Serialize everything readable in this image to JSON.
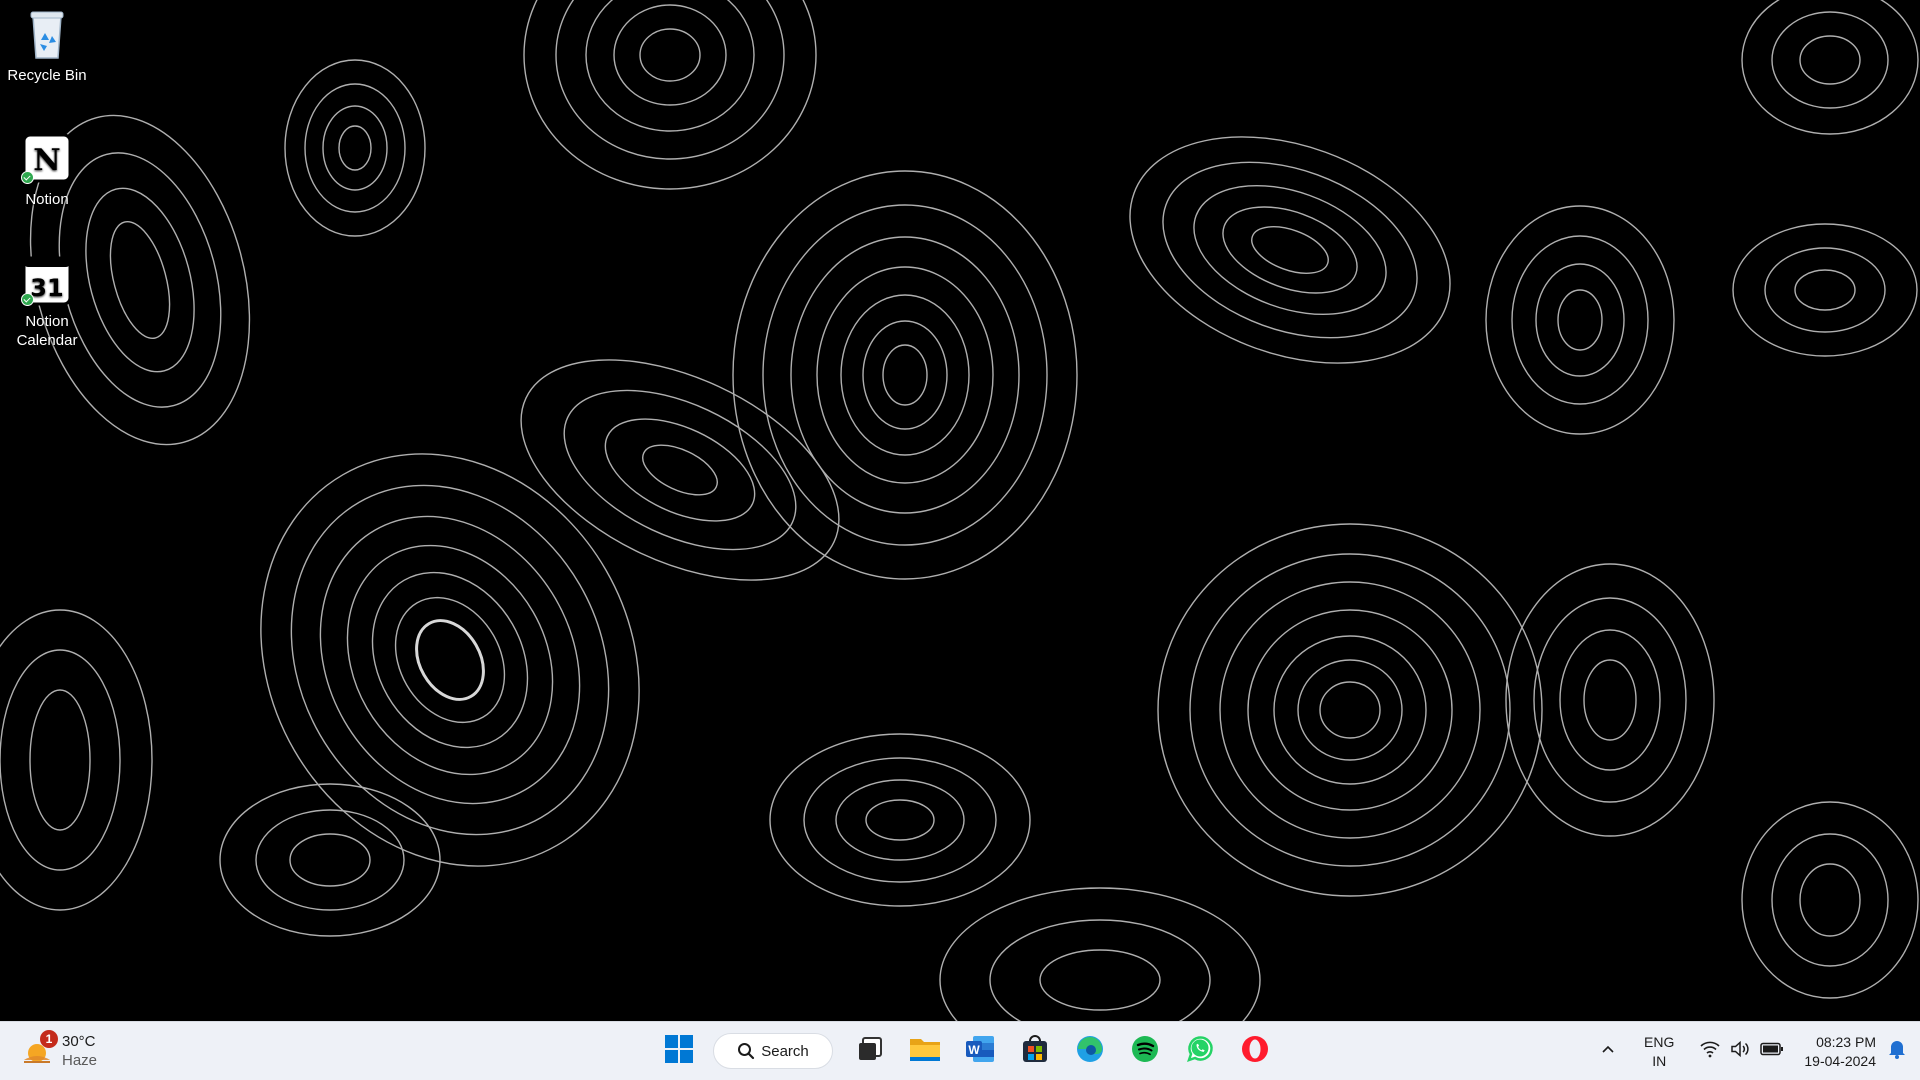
{
  "desktop": {
    "icons": [
      {
        "label": "Recycle Bin",
        "icon": "recycle-bin-icon"
      },
      {
        "label": "Notion",
        "icon": "notion-icon"
      },
      {
        "label": "Notion Calendar",
        "icon": "notion-calendar-icon",
        "date_number": "31"
      }
    ]
  },
  "taskbar": {
    "weather": {
      "temperature": "30°C",
      "condition": "Haze",
      "badge_count": "1",
      "icon": "weather-sun-icon"
    },
    "search": {
      "label": "Search"
    },
    "apps": [
      {
        "name": "Start",
        "icon": "windows-start-icon"
      },
      {
        "name": "Task View",
        "icon": "task-view-icon"
      },
      {
        "name": "File Explorer",
        "icon": "file-explorer-icon"
      },
      {
        "name": "Word",
        "icon": "word-icon",
        "letter": "W"
      },
      {
        "name": "Microsoft Store",
        "icon": "store-icon"
      },
      {
        "name": "Edge",
        "icon": "edge-icon"
      },
      {
        "name": "Spotify",
        "icon": "spotify-icon"
      },
      {
        "name": "WhatsApp",
        "icon": "whatsapp-icon"
      },
      {
        "name": "Opera",
        "icon": "opera-icon"
      }
    ],
    "tray": {
      "language_line1": "ENG",
      "language_line2": "IN",
      "time": "08:23 PM",
      "date": "19-04-2024"
    }
  },
  "colors": {
    "taskbar_bg": "#eef1f7",
    "windows_blue": "#0078d4",
    "spotify_green": "#1db954",
    "whatsapp_green": "#25d366",
    "opera_red": "#ff1b2d",
    "badge_red": "#c42b1c"
  }
}
